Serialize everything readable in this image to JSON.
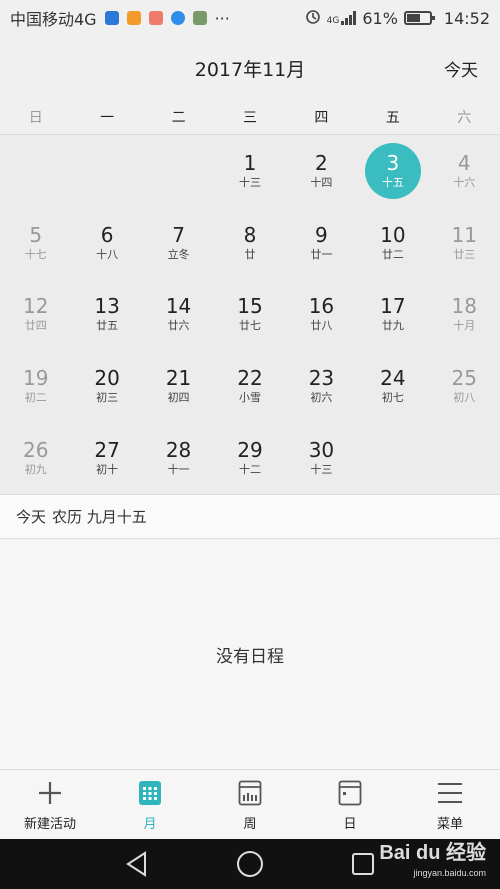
{
  "status": {
    "carrier": "中国移动4G",
    "battery": "61%",
    "time": "14:52",
    "net_label": "4G",
    "battery_level": 0.61
  },
  "header": {
    "title": "2017年11月",
    "today_label": "今天"
  },
  "weekdays": [
    "日",
    "一",
    "二",
    "三",
    "四",
    "五",
    "六"
  ],
  "calendar": {
    "rows": [
      [
        {
          "d": "",
          "l": ""
        },
        {
          "d": "",
          "l": ""
        },
        {
          "d": "",
          "l": ""
        },
        {
          "d": "1",
          "l": "十三"
        },
        {
          "d": "2",
          "l": "十四"
        },
        {
          "d": "3",
          "l": "十五",
          "today": true
        },
        {
          "d": "4",
          "l": "十六"
        }
      ],
      [
        {
          "d": "5",
          "l": "十七"
        },
        {
          "d": "6",
          "l": "十八"
        },
        {
          "d": "7",
          "l": "立冬"
        },
        {
          "d": "8",
          "l": "廿"
        },
        {
          "d": "9",
          "l": "廿一"
        },
        {
          "d": "10",
          "l": "廿二"
        },
        {
          "d": "11",
          "l": "廿三"
        }
      ],
      [
        {
          "d": "12",
          "l": "廿四"
        },
        {
          "d": "13",
          "l": "廿五"
        },
        {
          "d": "14",
          "l": "廿六"
        },
        {
          "d": "15",
          "l": "廿七"
        },
        {
          "d": "16",
          "l": "廿八"
        },
        {
          "d": "17",
          "l": "廿九"
        },
        {
          "d": "18",
          "l": "十月"
        }
      ],
      [
        {
          "d": "19",
          "l": "初二"
        },
        {
          "d": "20",
          "l": "初三"
        },
        {
          "d": "21",
          "l": "初四"
        },
        {
          "d": "22",
          "l": "小雪"
        },
        {
          "d": "23",
          "l": "初六"
        },
        {
          "d": "24",
          "l": "初七"
        },
        {
          "d": "25",
          "l": "初八"
        }
      ],
      [
        {
          "d": "26",
          "l": "初九"
        },
        {
          "d": "27",
          "l": "初十"
        },
        {
          "d": "28",
          "l": "十一"
        },
        {
          "d": "29",
          "l": "十二"
        },
        {
          "d": "30",
          "l": "十三"
        },
        {
          "d": "",
          "l": ""
        },
        {
          "d": "",
          "l": ""
        }
      ]
    ]
  },
  "info": {
    "today": "今天",
    "lunar": "农历 九月十五"
  },
  "events": {
    "empty": "没有日程"
  },
  "tabs": [
    {
      "label": "新建活动",
      "icon": "plus-icon"
    },
    {
      "label": "月",
      "icon": "month-grid-icon",
      "active": true
    },
    {
      "label": "周",
      "icon": "week-calendar-icon"
    },
    {
      "label": "日",
      "icon": "day-calendar-icon"
    },
    {
      "label": "菜单",
      "icon": "menu-icon"
    }
  ],
  "watermark": {
    "brand": "Bai du 经验",
    "url": "jingyan.baidu.com"
  },
  "colors": {
    "accent": "#3bbcc1",
    "active_tab": "#2fb6bd"
  }
}
